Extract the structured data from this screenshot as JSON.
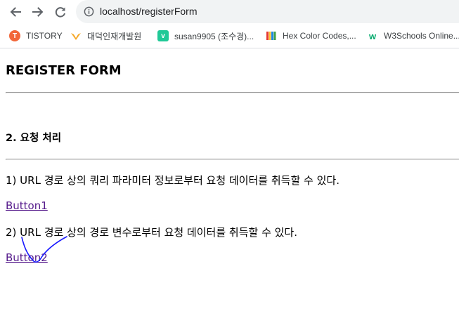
{
  "browser": {
    "url": "localhost/registerForm",
    "bookmarks": [
      {
        "label": "TISTORY",
        "icon": "tistory-icon",
        "color": "#f2673a"
      },
      {
        "label": "대덕인재개발원",
        "icon": "daedeok-icon",
        "color": "#f5a623"
      },
      {
        "label": "susan9905 (조수경)...",
        "icon": "velog-icon",
        "color": "#20c997"
      },
      {
        "label": "Hex Color Codes,...",
        "icon": "hex-color-codes-icon",
        "color": "#3366cc"
      },
      {
        "label": "W3Schools Online...",
        "icon": "w3schools-icon",
        "color": "#04aa6d"
      }
    ]
  },
  "page": {
    "title": "REGISTER FORM",
    "section_title": "2. 요청 처리",
    "items": [
      {
        "text": "1) URL 경로 상의 쿼리 파라미터 정보로부터 요청 데이터를 취득할 수 있다.",
        "link": "Button1"
      },
      {
        "text": "2) URL 경로 상의 경로 변수로부터 요청 데이터를 취득할 수 있다.",
        "link": "Button2"
      }
    ]
  },
  "colors": {
    "link": "#551a8b",
    "annotation": "#1a1aff"
  }
}
